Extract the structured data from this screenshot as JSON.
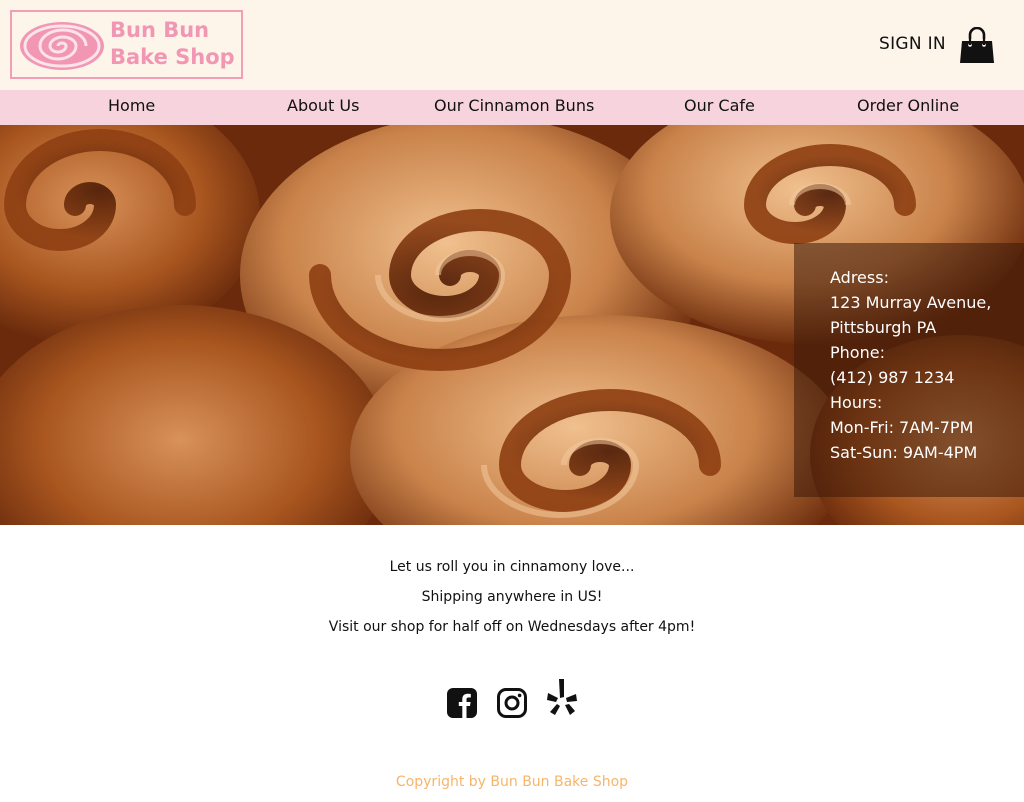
{
  "header": {
    "logo_line1": "Bun Bun",
    "logo_line2": "Bake Shop",
    "signin_label": "SIGN IN",
    "cart_icon": "shopping-bag-icon"
  },
  "nav": {
    "items": [
      {
        "label": "Home"
      },
      {
        "label": "About Us"
      },
      {
        "label": "Our Cinnamon Buns"
      },
      {
        "label": "Our Cafe"
      },
      {
        "label": "Order Online"
      }
    ]
  },
  "info": {
    "address_label": "Adress:",
    "address_line1": "123 Murray Avenue,",
    "address_line2": "Pittsburgh PA",
    "phone_label": "Phone:",
    "phone": "(412) 987 1234",
    "hours_label": "Hours:",
    "hours_weekday": "Mon-Fri: 7AM-7PM",
    "hours_weekend": "Sat-Sun: 9AM-4PM"
  },
  "promo": {
    "line1": "Let us roll you in cinnamony love...",
    "line2": "Shipping anywhere in US!",
    "line3": "Visit our shop for half off on Wednesdays after 4pm!"
  },
  "social": {
    "icons": [
      "facebook-icon",
      "instagram-icon",
      "yelp-icon"
    ]
  },
  "footer": {
    "copyright": "Copyright by Bun Bun Bake Shop"
  },
  "colors": {
    "header_bg": "#fdf4ea",
    "nav_bg": "#f7d3de",
    "brand_pink": "#f197b3",
    "copyright": "#f6b56b"
  }
}
